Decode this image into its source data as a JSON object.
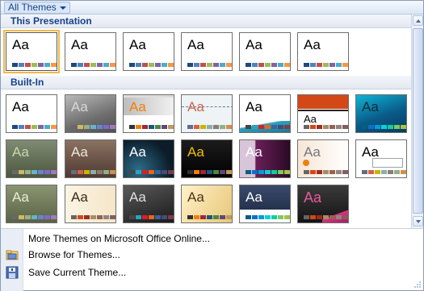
{
  "header": {
    "label": "All Themes"
  },
  "sections": {
    "this_presentation": "This Presentation",
    "built_in": "Built-In"
  },
  "thumb_text": "Aa",
  "menu": {
    "more_themes": "More Themes on Microsoft Office Online...",
    "browse": "Browse for Themes...",
    "save": "Save Current Theme..."
  },
  "palettes": {
    "office": [
      "#1f497d",
      "#4f81bd",
      "#c0504d",
      "#9bbb59",
      "#8064a2",
      "#4bacc6",
      "#f79646",
      "#eeece1"
    ],
    "apex": [
      "#69676d",
      "#ceb966",
      "#9cb084",
      "#6bb1c9",
      "#6585cf",
      "#7e6bc9",
      "#a379bb",
      "#c9c2d1"
    ],
    "aspect": [
      "#323232",
      "#f07f09",
      "#9f2936",
      "#1b587c",
      "#4e8542",
      "#604878",
      "#c19859",
      "#e3ded1"
    ],
    "civic": [
      "#646b86",
      "#d16349",
      "#ccb400",
      "#8cadae",
      "#8c7b70",
      "#8fb08c",
      "#d19049",
      "#c5d1d7"
    ],
    "concourse": [
      "#464646",
      "#2da2bf",
      "#da1f28",
      "#eb641b",
      "#39639d",
      "#474b78",
      "#7d3c4a",
      "#def5fa"
    ],
    "equity": [
      "#696464",
      "#d34817",
      "#9b2d1f",
      "#a28e6a",
      "#956251",
      "#918485",
      "#855d5d",
      "#e9e5dc"
    ],
    "flow": [
      "#04617b",
      "#0f6fc6",
      "#009dd9",
      "#0bd0d9",
      "#10cf9b",
      "#7cca62",
      "#a5c249",
      "#dbf5f9"
    ]
  }
}
